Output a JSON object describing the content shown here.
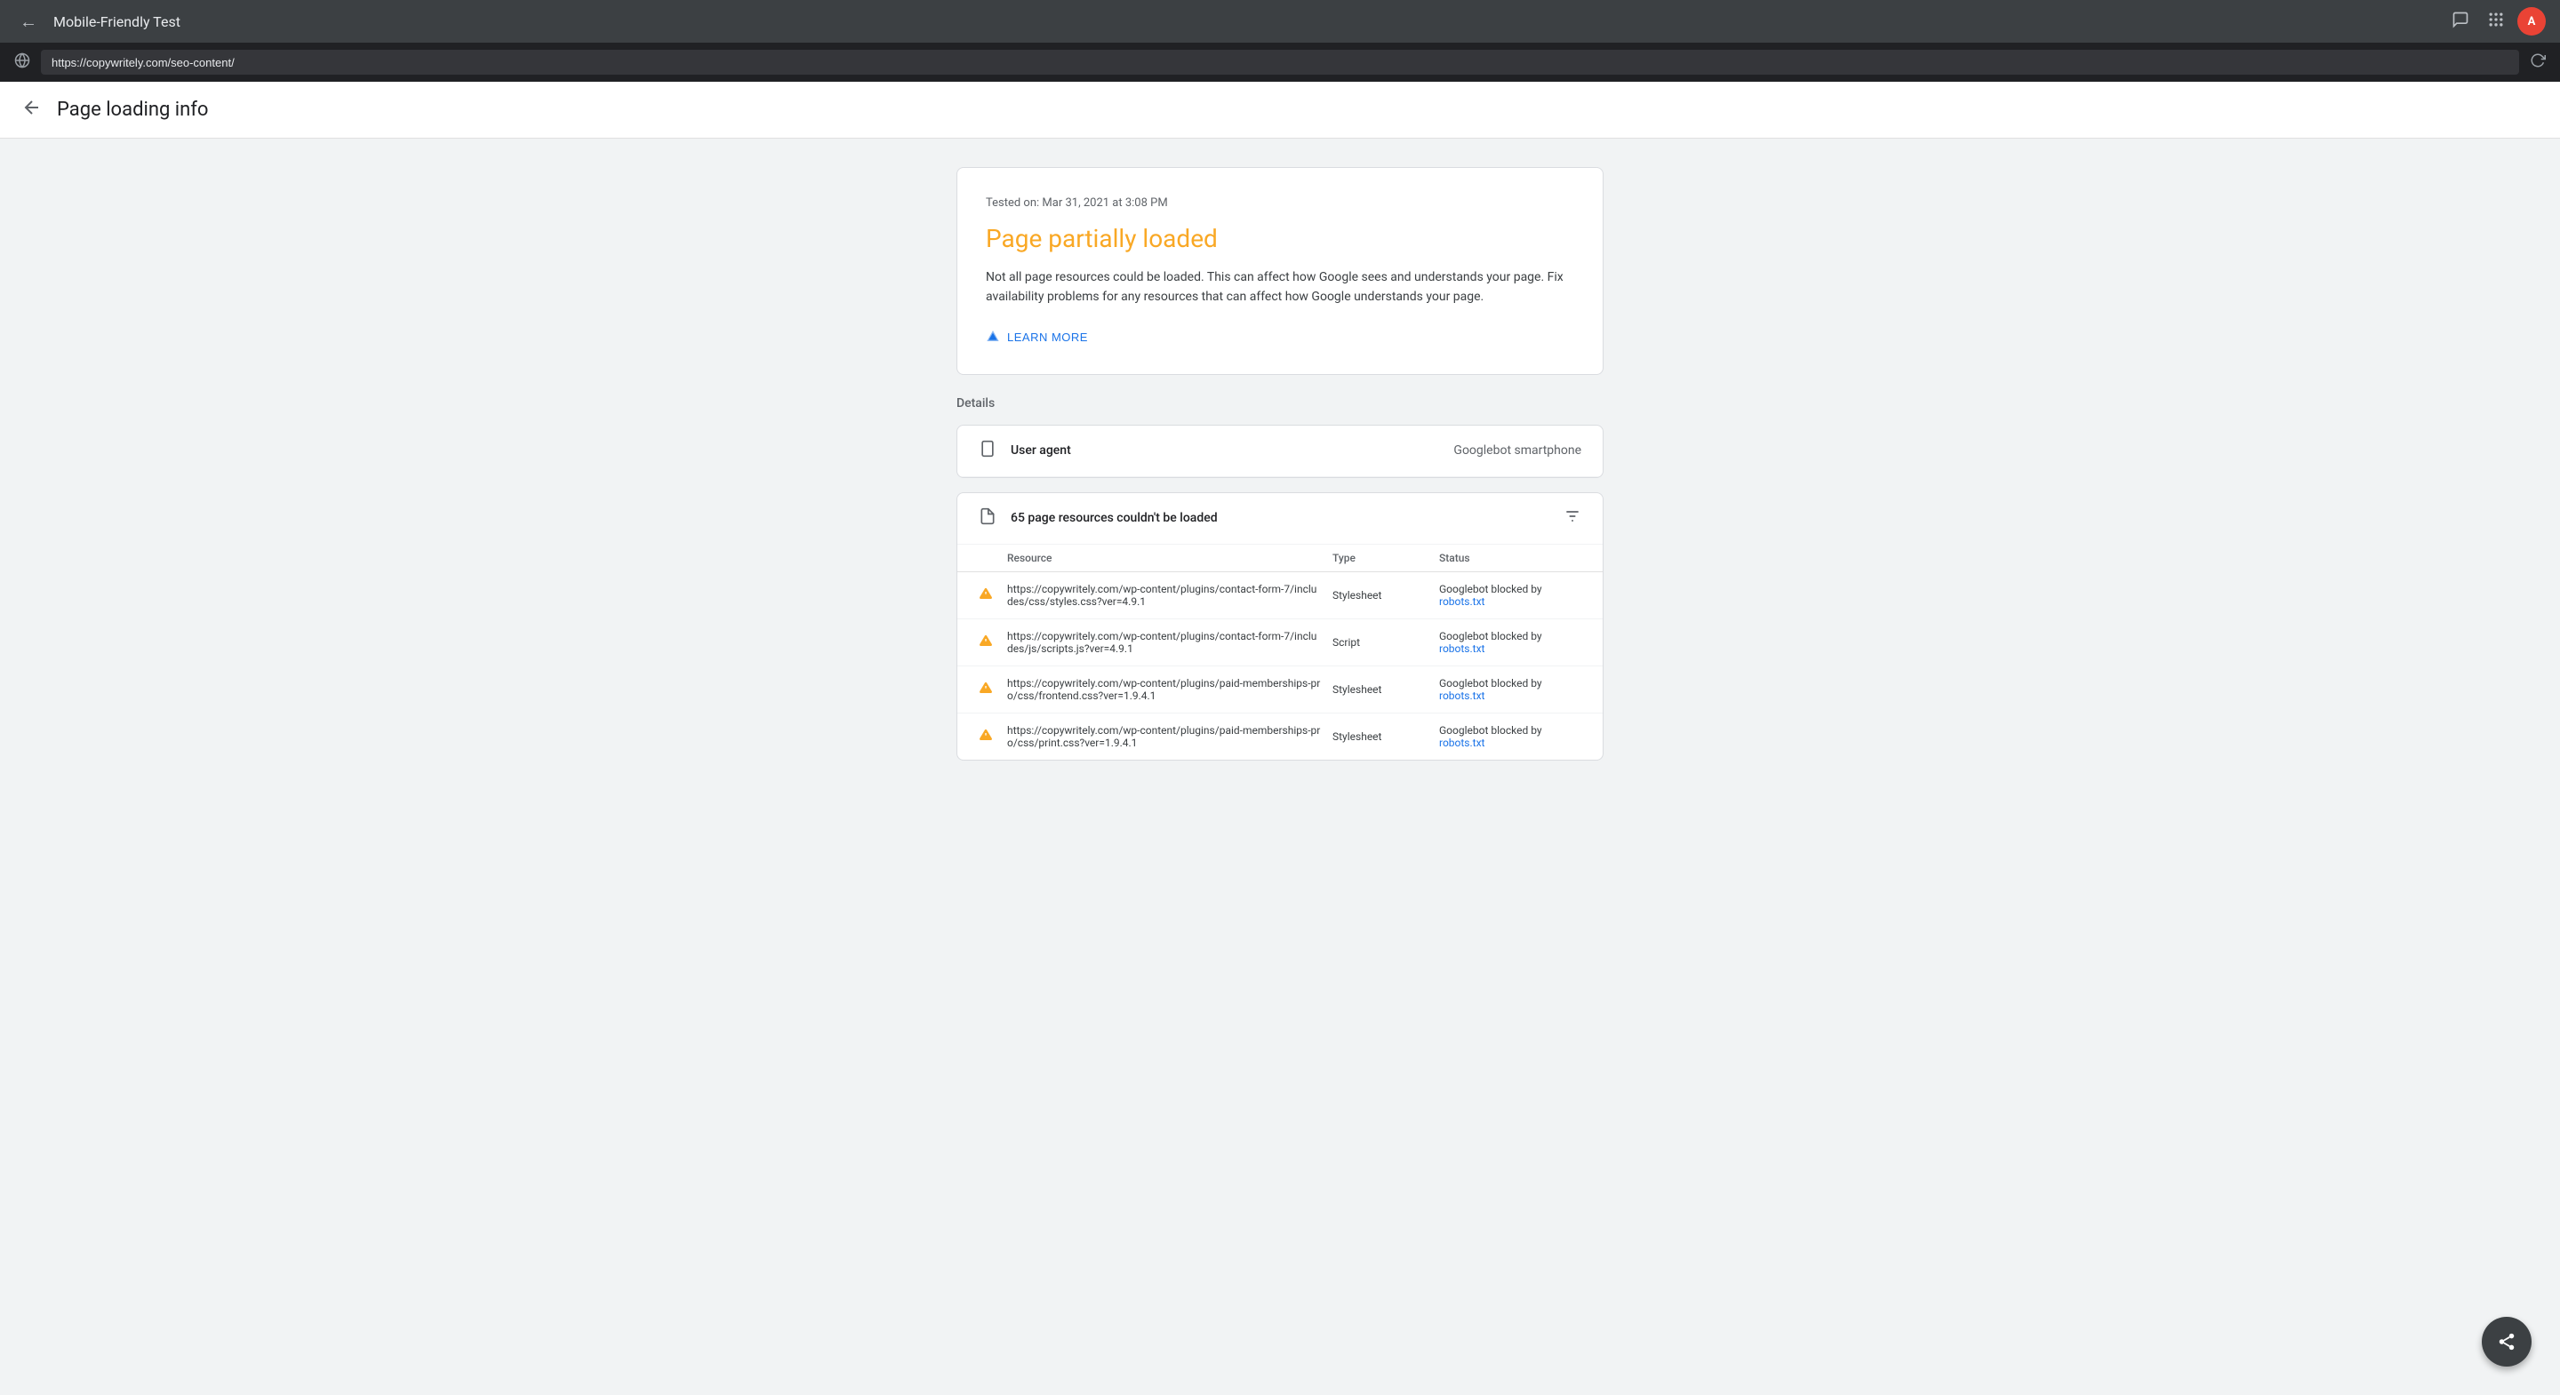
{
  "chrome": {
    "back_label": "←",
    "title": "Mobile-Friendly Test",
    "address": "https://copywritely.com/seo-content/",
    "feedback_icon": "💬",
    "apps_icon": "⋮⋮⋮",
    "avatar_label": "A",
    "reload_icon": "↻",
    "globe_icon": "🌐"
  },
  "page_header": {
    "back_label": "←",
    "title": "Page loading info"
  },
  "status_card": {
    "tested_on": "Tested on: Mar 31, 2021 at 3:08 PM",
    "title": "Page partially loaded",
    "description": "Not all page resources could be loaded. This can affect how Google sees and understands your page. Fix availability problems for any resources that can affect how Google understands your page.",
    "learn_more_label": "LEARN MORE"
  },
  "details": {
    "label": "Details",
    "user_agent_label": "User agent",
    "user_agent_value": "Googlebot smartphone",
    "resources_label": "65 page resources couldn't be loaded",
    "columns": {
      "resource": "Resource",
      "type": "Type",
      "status": "Status"
    },
    "resources": [
      {
        "url": "https://copywritely.com/wp-content/plugins/contact-form-7/includes/css/styles.css?ver=4.9.1",
        "type": "Stylesheet",
        "status_text": "Googlebot blocked by",
        "status_link": "robots.txt"
      },
      {
        "url": "https://copywritely.com/wp-content/plugins/contact-form-7/includes/js/scripts.js?ver=4.9.1",
        "type": "Script",
        "status_text": "Googlebot blocked by",
        "status_link": "robots.txt"
      },
      {
        "url": "https://copywritely.com/wp-content/plugins/paid-memberships-pro/css/frontend.css?ver=1.9.4.1",
        "type": "Stylesheet",
        "status_text": "Googlebot blocked by",
        "status_link": "robots.txt"
      },
      {
        "url": "https://copywritely.com/wp-content/plugins/paid-memberships-pro/css/print.css?ver=1.9.4.1",
        "type": "Stylesheet",
        "status_text": "Googlebot blocked by",
        "status_link": "robots.txt"
      }
    ]
  },
  "share_fab": {
    "icon": "↗"
  }
}
